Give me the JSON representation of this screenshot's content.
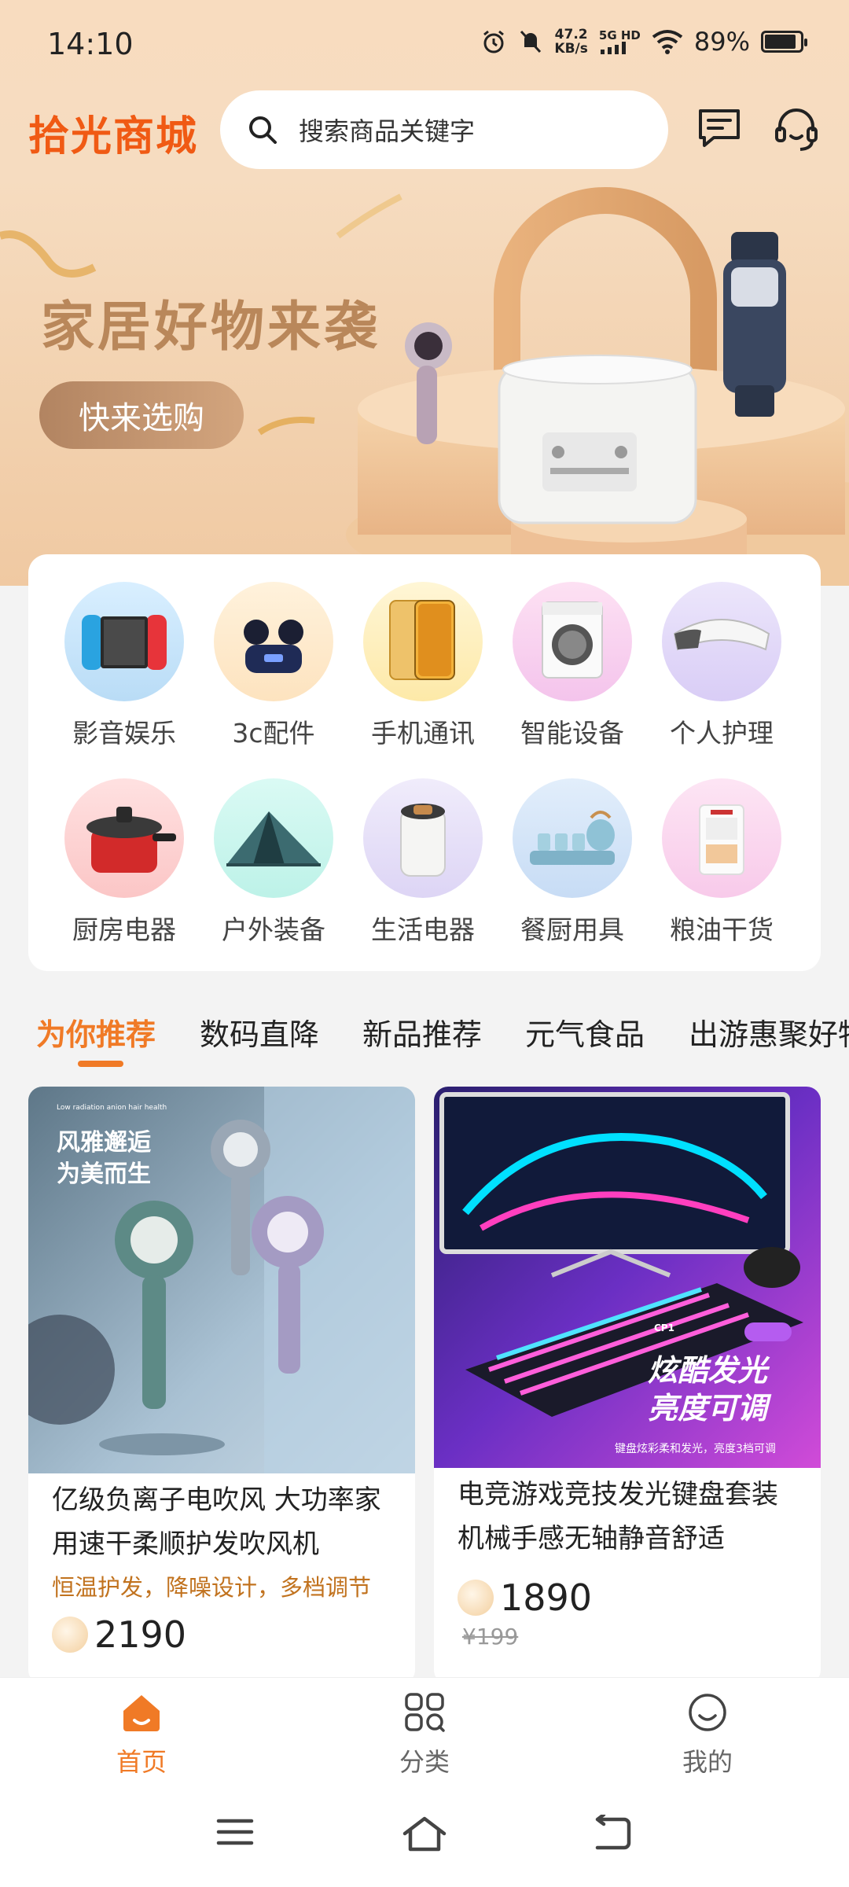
{
  "status_bar": {
    "time": "14:10",
    "net_speed_value": "47.2",
    "net_speed_unit": "KB/s",
    "net_type": "5G HD",
    "battery": "89%"
  },
  "header": {
    "logo": "拾光商城",
    "search_placeholder": "搜索商品关键字"
  },
  "banner": {
    "title": "家居好物来袭",
    "button": "快来选购"
  },
  "categories": [
    {
      "label": "影音娱乐"
    },
    {
      "label": "3c配件"
    },
    {
      "label": "手机通讯"
    },
    {
      "label": "智能设备"
    },
    {
      "label": "个人护理"
    },
    {
      "label": "厨房电器"
    },
    {
      "label": "户外装备"
    },
    {
      "label": "生活电器"
    },
    {
      "label": "餐厨用具"
    },
    {
      "label": "粮油干货"
    }
  ],
  "tabs": [
    "为你推荐",
    "数码直降",
    "新品推荐",
    "元气食品",
    "出游惠聚好物"
  ],
  "products": [
    {
      "image_text_small": "Low radiation anion hair health",
      "image_text_line1": "风雅邂逅",
      "image_text_line2": "为美而生",
      "title": "亿级负离子电吹风 大功率家用速干柔顺护发吹风机",
      "subtitle": "恒温护发，降噪设计，多档调节",
      "price": "2190"
    },
    {
      "image_text_line1": "炫酷发光",
      "image_text_line2": "亮度可调",
      "image_text_small": "键盘炫彩柔和发光，亮度3档可调",
      "image_badge": "CP1",
      "title": "电竞游戏竞技发光键盘套装 机械手感无轴静音舒适",
      "price": "1890",
      "old_price": "¥199"
    }
  ],
  "bottom_nav": [
    {
      "label": "首页"
    },
    {
      "label": "分类"
    },
    {
      "label": "我的"
    }
  ],
  "colors": {
    "accent": "#f07a26",
    "logo": "#f05a14",
    "banner_title": "#b9875a"
  }
}
